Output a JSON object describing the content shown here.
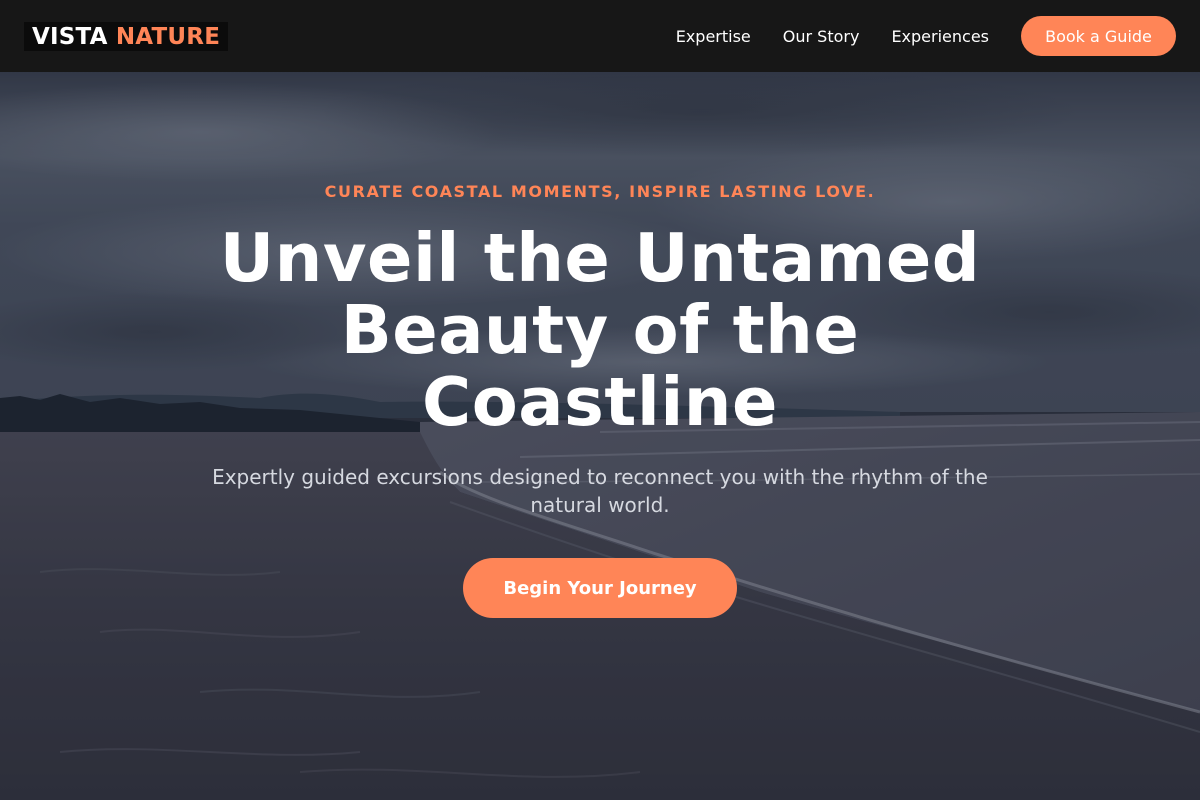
{
  "brand": {
    "logo_word_1": "VISTA",
    "logo_word_2": "NATURE"
  },
  "nav": {
    "links": [
      {
        "label": "Expertise"
      },
      {
        "label": "Our Story"
      },
      {
        "label": "Experiences"
      }
    ],
    "cta_label": "Book a Guide"
  },
  "hero": {
    "background": "coastal-beach-overcast-photo",
    "eyebrow": "CURATE COASTAL MOMENTS, INSPIRE LASTING LOVE.",
    "headline_lines": [
      "Unveil the Untamed",
      "Beauty of the",
      "Coastline"
    ],
    "subheadline": "Expertly guided excursions designed to reconnect you with the rhythm of the natural world.",
    "cta_label": "Begin Your Journey"
  },
  "colors": {
    "accent": "#ff8557",
    "navbar_bg": "#171717",
    "headline_text": "#ffffff",
    "subhead_text": "#d6d9e0"
  }
}
